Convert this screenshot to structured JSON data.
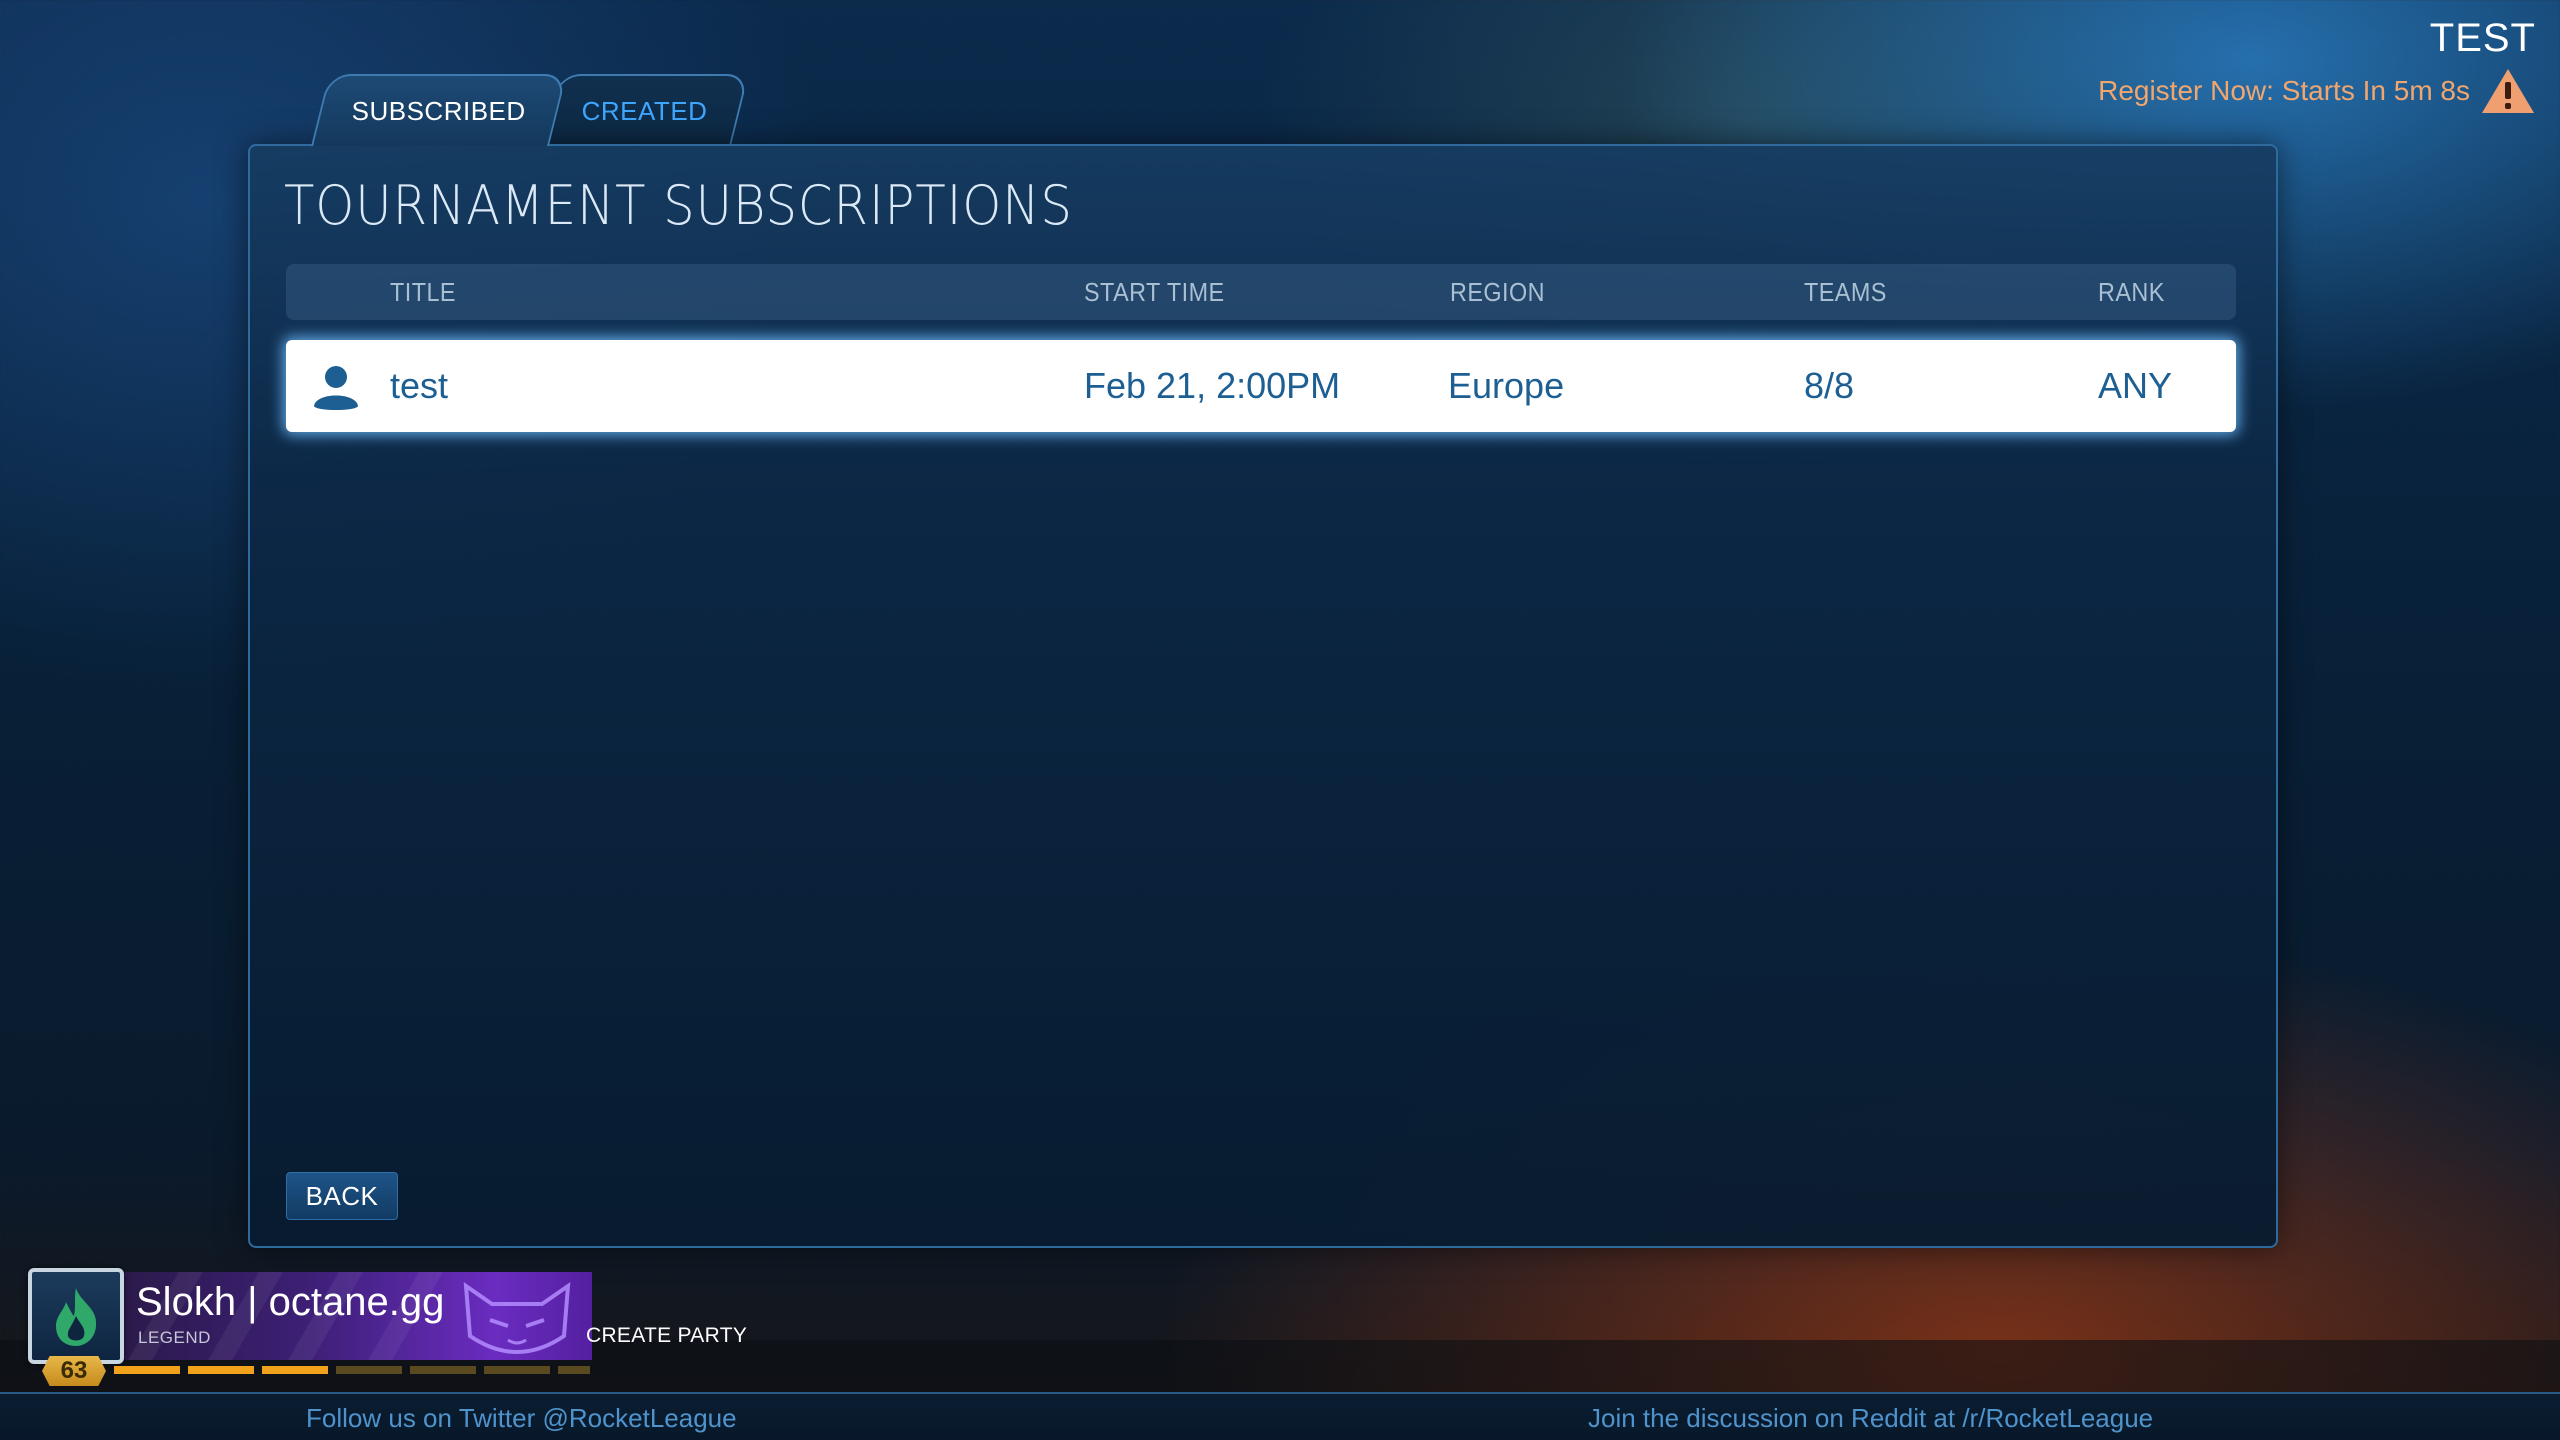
{
  "notification": {
    "title": "TEST",
    "message": "Register Now: Starts In 5m 8s",
    "icon": "warning-icon",
    "message_color": "#f0a66e"
  },
  "tabs": [
    {
      "label": "SUBSCRIBED",
      "active": true
    },
    {
      "label": "CREATED",
      "active": false
    }
  ],
  "panel": {
    "title": "TOURNAMENT SUBSCRIPTIONS",
    "columns": {
      "title": "TITLE",
      "start_time": "START TIME",
      "region": "REGION",
      "teams": "TEAMS",
      "rank": "RANK"
    },
    "rows": [
      {
        "icon": "user-icon",
        "title": "test",
        "start_time": "Feb 21, 2:00PM",
        "region": "Europe",
        "teams": "8/8",
        "rank": "ANY"
      }
    ],
    "back_label": "BACK"
  },
  "player": {
    "name": "Slokh | octane.gg",
    "rank_title": "LEGEND",
    "level": "63",
    "xp_progress": 0.45,
    "avatar_icon": "flame-icon",
    "banner_color": "#6a2cc0"
  },
  "party": {
    "create_label": "CREATE PARTY"
  },
  "footer": {
    "twitter": "Follow us on Twitter @RocketLeague",
    "reddit": "Join the discussion on Reddit at /r/RocketLeague"
  },
  "colors": {
    "accent": "#3ea6ff",
    "row_text": "#1d5f92",
    "level_badge": "#e8b84a"
  }
}
